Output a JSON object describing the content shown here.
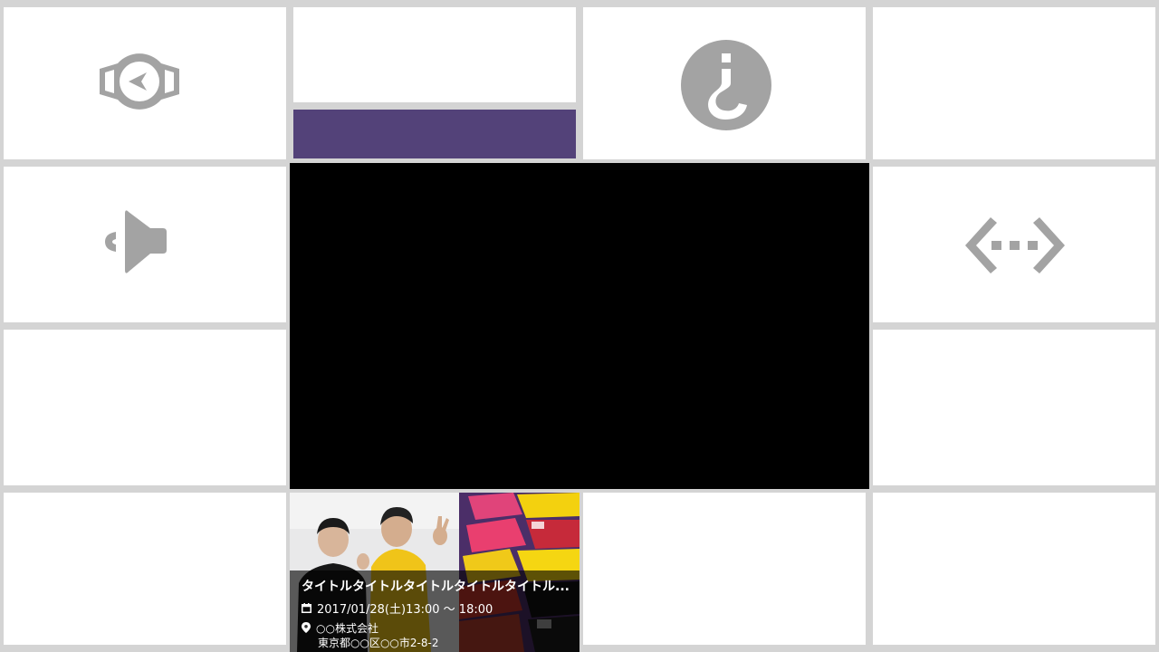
{
  "tiles": {
    "compass_icon": "compass-icon",
    "question_icon": "question-mark-icon",
    "megaphone_icon": "megaphone-icon",
    "code_icon": "code-brackets-icon"
  },
  "colors": {
    "background": "#d4d4d4",
    "tile": "#ffffff",
    "icon": "#a3a3a3",
    "accent_purple": "#534279",
    "video": "#000000"
  },
  "event": {
    "title": "タイトルタイトルタイトルタイトルタイトル...",
    "datetime": "2017/01/28(土)13:00 〜 18:00",
    "venue": "○○株式会社",
    "address": "東京都○○区○○市2-8-2"
  }
}
